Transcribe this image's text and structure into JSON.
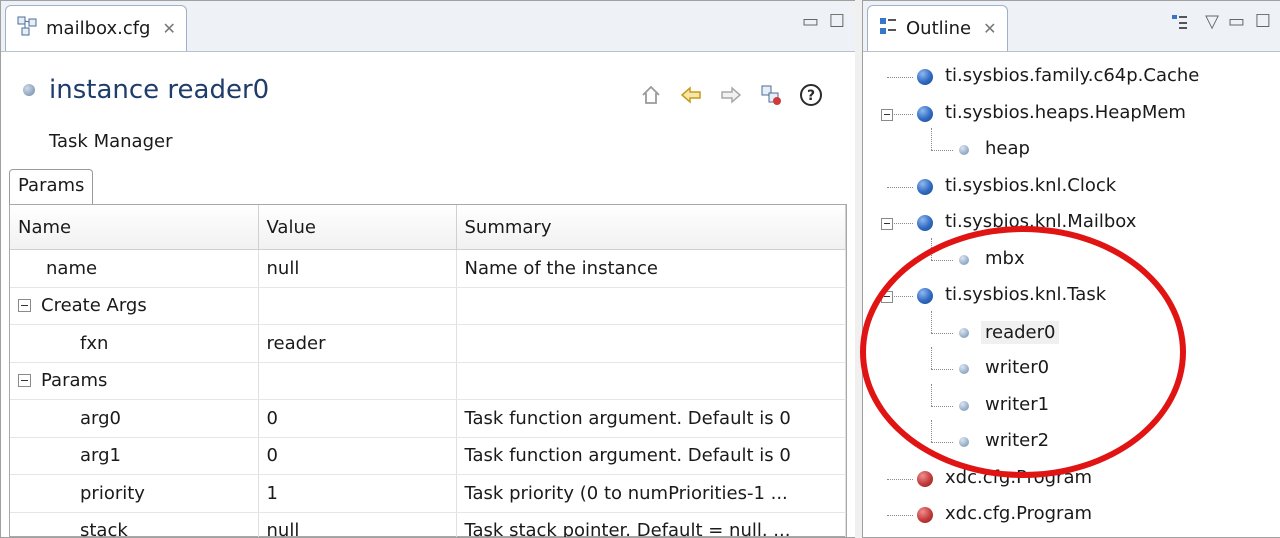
{
  "editor": {
    "tab_label": "mailbox.cfg",
    "tab_close": "✕",
    "title": "instance reader0",
    "subtitle": "Task Manager",
    "subtab": "Params",
    "columns": [
      "Name",
      "Value",
      "Summary"
    ],
    "rows": [
      {
        "name": "name",
        "value": "null",
        "summary": "Name of the instance"
      },
      {
        "group": "Create Args"
      },
      {
        "name": "fxn",
        "value": "reader",
        "summary": ""
      },
      {
        "group": "Params"
      },
      {
        "name": "arg0",
        "value": "0",
        "summary": "Task function argument. Default is 0"
      },
      {
        "name": "arg1",
        "value": "0",
        "summary": "Task function argument. Default is 0"
      },
      {
        "name": "priority",
        "value": "1",
        "summary": "Task priority (0 to numPriorities-1 ..."
      },
      {
        "name": "stack",
        "value": "null",
        "summary": "Task stack pointer. Default = null. ..."
      }
    ]
  },
  "outline": {
    "tab_label": "Outline",
    "tab_close": "✕",
    "items": [
      {
        "label": "ti.sysbios.family.c64p.Cache",
        "level": 0,
        "color": "blue"
      },
      {
        "label": "ti.sysbios.heaps.HeapMem",
        "level": 0,
        "color": "blue",
        "expanded": true
      },
      {
        "label": "heap",
        "level": 1,
        "color": "small"
      },
      {
        "label": "ti.sysbios.knl.Clock",
        "level": 0,
        "color": "blue"
      },
      {
        "label": "ti.sysbios.knl.Mailbox",
        "level": 0,
        "color": "blue",
        "expanded": true
      },
      {
        "label": "mbx",
        "level": 1,
        "color": "small"
      },
      {
        "label": "ti.sysbios.knl.Task",
        "level": 0,
        "color": "blue",
        "expanded": true
      },
      {
        "label": "reader0",
        "level": 1,
        "color": "small",
        "selected": true
      },
      {
        "label": "writer0",
        "level": 1,
        "color": "small"
      },
      {
        "label": "writer1",
        "level": 1,
        "color": "small"
      },
      {
        "label": "writer2",
        "level": 1,
        "color": "small"
      },
      {
        "label": "xdc.cfg.Program",
        "level": 0,
        "color": "red"
      },
      {
        "label": "xdc.cfg.Program",
        "level": 0,
        "color": "red"
      }
    ]
  },
  "colors": {
    "title": "#1f3d6b",
    "annotation_ring": "#e11414",
    "selection": "#f0f0f0"
  }
}
